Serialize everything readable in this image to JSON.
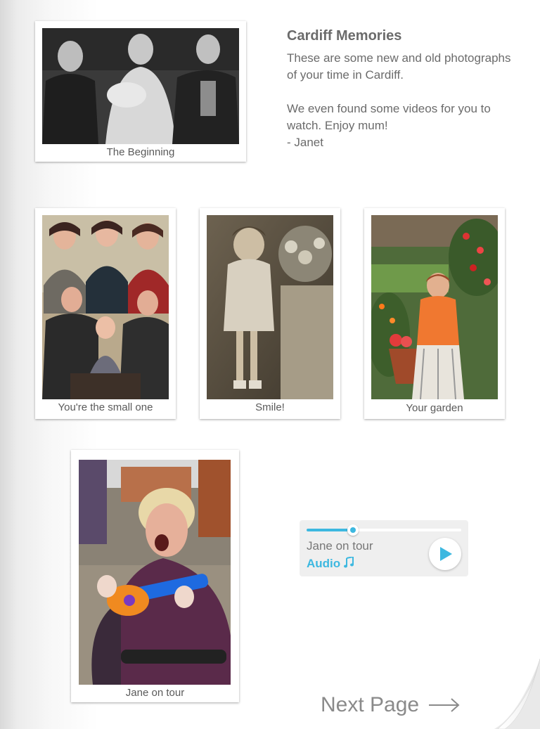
{
  "intro": {
    "title": "Cardiff Memories",
    "paragraph1": "These are some new and old photographs of your time in Cardiff.",
    "paragraph2": "We even found some videos for you to watch. Enjoy mum!",
    "signature": "- Janet"
  },
  "photos": [
    {
      "caption": "The Beginning"
    },
    {
      "caption": "You're the small one"
    },
    {
      "caption": "Smile!"
    },
    {
      "caption": "Your garden"
    },
    {
      "caption": "Jane on tour"
    }
  ],
  "audio": {
    "title": "Jane on tour",
    "type_label": "Audio",
    "type_icon": "music-note-icon",
    "progress": 0.3,
    "accent_color": "#3db8e0"
  },
  "navigation": {
    "next_label": "Next Page",
    "next_icon": "arrow-right-icon"
  }
}
